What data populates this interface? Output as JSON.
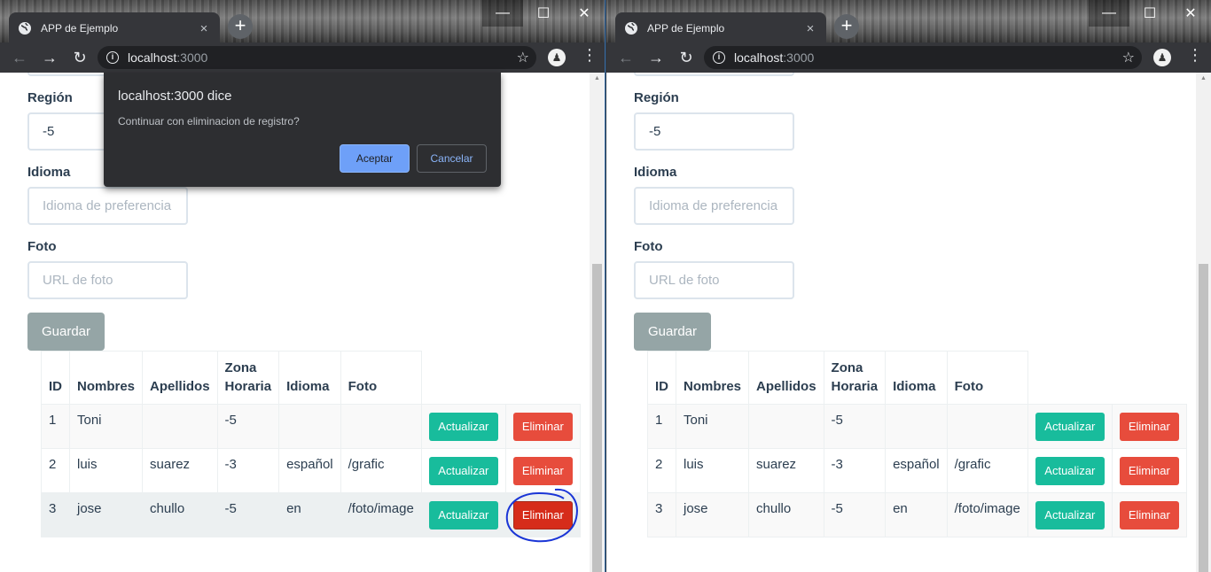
{
  "browser": {
    "tab_title": "APP de Ejemplo",
    "tab_close": "×",
    "new_tab": "+",
    "url_host": "localhost",
    "url_port": ":3000",
    "window_controls": [
      "—",
      "☐",
      "✕"
    ]
  },
  "form": {
    "region_label": "Región",
    "region_value": "-5",
    "idioma_label": "Idioma",
    "idioma_placeholder": "Idioma de preferencia",
    "foto_label": "Foto",
    "foto_placeholder": "URL de foto",
    "save_button": "Guardar"
  },
  "table": {
    "headers": [
      "ID",
      "Nombres",
      "Apellidos",
      "Zona Horaria",
      "Idioma",
      "Foto"
    ],
    "update_label": "Actualizar",
    "delete_label": "Eliminar",
    "rows": [
      {
        "id": "1",
        "nombres": "Toni",
        "apellidos": "",
        "zona": "-5",
        "idioma": "",
        "foto": ""
      },
      {
        "id": "2",
        "nombres": "luis",
        "apellidos": "suarez",
        "zona": "-3",
        "idioma": "español",
        "foto": "/grafic"
      },
      {
        "id": "3",
        "nombres": "jose",
        "apellidos": "chullo",
        "zona": "-5",
        "idioma": "en",
        "foto": "/foto/image"
      }
    ]
  },
  "dialog": {
    "title": "localhost:3000 dice",
    "message": "Continuar con eliminacion de registro?",
    "ok_label": "Aceptar",
    "cancel_label": "Cancelar"
  },
  "colors": {
    "primary_teal": "#18bc9c",
    "danger_red": "#e74c3c",
    "secondary_gray": "#95a5a6",
    "annotation_blue": "#1a35d6"
  },
  "icons": [
    "globe-icon",
    "back-arrow-icon",
    "forward-arrow-icon",
    "reload-icon",
    "info-icon",
    "star-icon",
    "menu-dots-icon",
    "avatar-icon"
  ]
}
